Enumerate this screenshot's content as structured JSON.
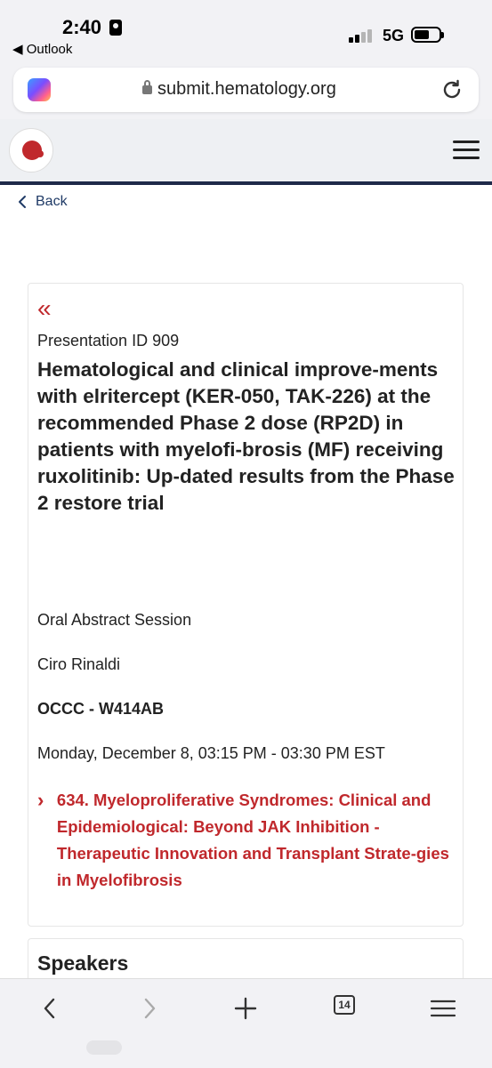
{
  "status_bar": {
    "time": "2:40",
    "back_app": "◀ Outlook",
    "network": "5G"
  },
  "browser": {
    "url": "submit.hematology.org",
    "tab_count": "14"
  },
  "nav": {
    "back_label": "Back"
  },
  "abstract": {
    "collapse_glyph": "«",
    "presentation_id": "Presentation ID 909",
    "title": "Hematological and clinical improve-ments with elritercept (KER-050, TAK-226) at the recommended Phase 2 dose (RP2D) in patients with myelofi-brosis (MF) receiving ruxolitinib: Up-dated results from the Phase 2 restore trial",
    "session_type": "Oral Abstract Session",
    "presenter": "Ciro Rinaldi",
    "location": "OCCC - W414AB",
    "datetime": "Monday, December 8, 03:15 PM - 03:30 PM EST",
    "track": "634. Myeloproliferative Syndromes: Clinical and Epidemiological: Beyond JAK Inhibition - Therapeutic Innovation and Transplant Strate-gies in Myelofibrosis"
  },
  "speakers": {
    "heading": "Speakers"
  },
  "colors": {
    "accent": "#c0282c",
    "header_border": "#1f2a4a",
    "link": "#1f3a66"
  }
}
